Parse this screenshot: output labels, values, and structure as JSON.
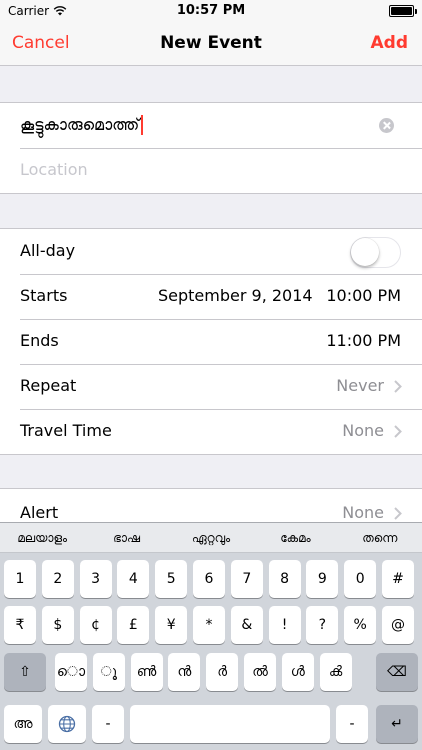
{
  "status": {
    "carrier": "Carrier",
    "time": "10:57 PM",
    "battery_level": 1.0
  },
  "nav": {
    "cancel_label": "Cancel",
    "title": "New Event",
    "add_label": "Add"
  },
  "event": {
    "title_value": "കൂട്ടുകാരുമൊത്ത്",
    "location_placeholder": "Location"
  },
  "details": {
    "allday_label": "All-day",
    "starts_label": "Starts",
    "starts_date": "September 9, 2014",
    "starts_time": "10:00 PM",
    "ends_label": "Ends",
    "ends_time": "11:00 PM",
    "repeat_label": "Repeat",
    "repeat_value": "Never",
    "travel_label": "Travel Time",
    "travel_value": "None"
  },
  "alert": {
    "label": "Alert",
    "value": "None"
  },
  "keyboard": {
    "suggestions": [
      "മലയാളം",
      "ഭാഷ",
      "ഏറ്റവും",
      "കേമം",
      "തന്നെ"
    ],
    "row1": [
      "1",
      "2",
      "3",
      "4",
      "5",
      "6",
      "7",
      "8",
      "9",
      "0",
      "#"
    ],
    "row2": [
      "₹",
      "$",
      "¢",
      "£",
      "¥",
      "*",
      "&",
      "!",
      "?",
      "%",
      "@"
    ],
    "row3_shift": "⇧",
    "row3": [
      "ൊ",
      "ൂ",
      "ൺ",
      "ൻ",
      "ർ",
      "ൽ",
      "ൾ",
      "ൿ"
    ],
    "row3_delete": "⌫",
    "row4_lang": "അ",
    "row4_punct": "-",
    "row4_space": "",
    "row4_punct2": "-",
    "row4_return": "↵"
  }
}
